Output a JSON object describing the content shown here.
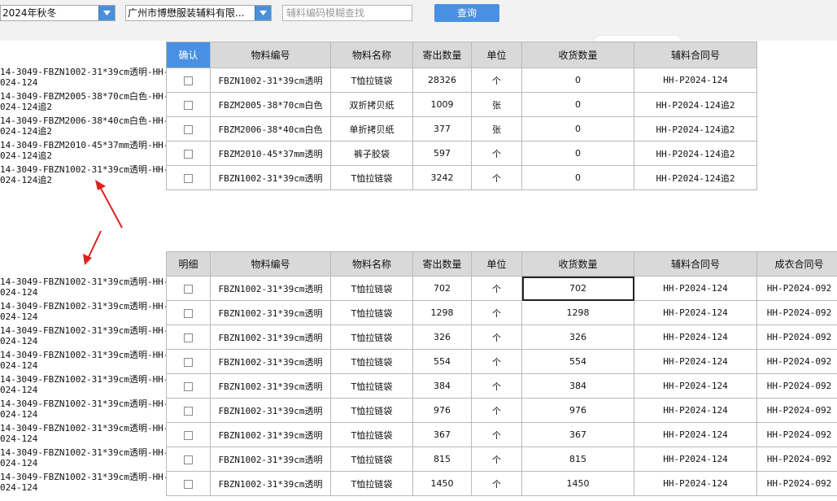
{
  "filters": {
    "season": "2024年秋冬",
    "supplier": "广州市博懋服装辅料有限...",
    "search_placeholder": "辅料编码模糊查找",
    "query_label": "查询"
  },
  "top_table": {
    "headers": [
      "确认",
      "物料编号",
      "物料名称",
      "寄出数量",
      "单位",
      "收货数量",
      "辅料合同号"
    ],
    "left_labels": [
      "14-3049-FBZN1002-31*39cm透明-HH-\n024-124",
      "14-3049-FBZM2005-38*70cm白色-HH-\n024-124追2",
      "14-3049-FBZM2006-38*40cm白色-HH-\n024-124追2",
      "14-3049-FBZM2010-45*37mm透明-HH-\n024-124追2",
      "14-3049-FBZN1002-31*39cm透明-HH-\n024-124追2"
    ],
    "rows": [
      [
        "FBZN1002-31*39cm透明",
        "T恤拉链袋",
        "28326",
        "个",
        "0",
        "HH-P2024-124"
      ],
      [
        "FBZM2005-38*70cm白色",
        "双折拷贝纸",
        "1009",
        "张",
        "0",
        "HH-P2024-124追2"
      ],
      [
        "FBZM2006-38*40cm白色",
        "单折拷贝纸",
        "377",
        "张",
        "0",
        "HH-P2024-124追2"
      ],
      [
        "FBZM2010-45*37mm透明",
        "裤子胶袋",
        "597",
        "个",
        "0",
        "HH-P2024-124追2"
      ],
      [
        "FBZN1002-31*39cm透明",
        "T恤拉链袋",
        "3242",
        "个",
        "0",
        "HH-P2024-124追2"
      ]
    ]
  },
  "bottom_table": {
    "headers": [
      "明细",
      "物料编号",
      "物料名称",
      "寄出数量",
      "单位",
      "收货数量",
      "辅料合同号",
      "成衣合同号"
    ],
    "left_labels": [
      "14-3049-FBZN1002-31*39cm透明-HH-\n024-124",
      "14-3049-FBZN1002-31*39cm透明-HH-\n024-124",
      "14-3049-FBZN1002-31*39cm透明-HH-\n024-124",
      "14-3049-FBZN1002-31*39cm透明-HH-\n024-124",
      "14-3049-FBZN1002-31*39cm透明-HH-\n024-124",
      "14-3049-FBZN1002-31*39cm透明-HH-\n024-124",
      "14-3049-FBZN1002-31*39cm透明-HH-\n024-124",
      "14-3049-FBZN1002-31*39cm透明-HH-\n024-124",
      "14-3049-FBZN1002-31*39cm透明-HH-\n024-124"
    ],
    "rows": [
      [
        "FBZN1002-31*39cm透明",
        "T恤拉链袋",
        "702",
        "个",
        "702",
        "HH-P2024-124",
        "HH-P2024-092"
      ],
      [
        "FBZN1002-31*39cm透明",
        "T恤拉链袋",
        "1298",
        "个",
        "1298",
        "HH-P2024-124",
        "HH-P2024-092"
      ],
      [
        "FBZN1002-31*39cm透明",
        "T恤拉链袋",
        "326",
        "个",
        "326",
        "HH-P2024-124",
        "HH-P2024-092"
      ],
      [
        "FBZN1002-31*39cm透明",
        "T恤拉链袋",
        "554",
        "个",
        "554",
        "HH-P2024-124",
        "HH-P2024-092"
      ],
      [
        "FBZN1002-31*39cm透明",
        "T恤拉链袋",
        "384",
        "个",
        "384",
        "HH-P2024-124",
        "HH-P2024-092"
      ],
      [
        "FBZN1002-31*39cm透明",
        "T恤拉链袋",
        "976",
        "个",
        "976",
        "HH-P2024-124",
        "HH-P2024-092"
      ],
      [
        "FBZN1002-31*39cm透明",
        "T恤拉链袋",
        "367",
        "个",
        "367",
        "HH-P2024-124",
        "HH-P2024-092"
      ],
      [
        "FBZN1002-31*39cm透明",
        "T恤拉链袋",
        "815",
        "个",
        "815",
        "HH-P2024-124",
        "HH-P2024-092"
      ],
      [
        "FBZN1002-31*39cm透明",
        "T恤拉链袋",
        "1450",
        "个",
        "1450",
        "HH-P2024-124",
        "HH-P2024-092"
      ]
    ]
  },
  "colors": {
    "accent": "#4a90e2",
    "header_gray": "#d9d9d9",
    "annotation_red": "#e02020"
  }
}
